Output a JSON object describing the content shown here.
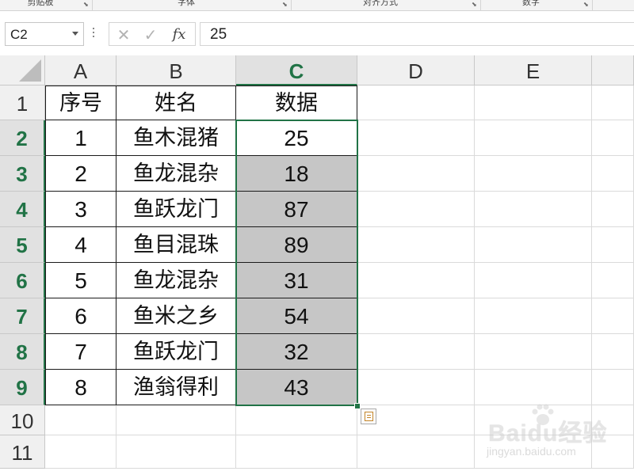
{
  "ribbon": {
    "groups": [
      {
        "label": "剪贴板"
      },
      {
        "label": "字体"
      },
      {
        "label": "对齐方式"
      },
      {
        "label": "数字"
      }
    ]
  },
  "formula_bar": {
    "name_box": "C2",
    "cancel_icon": "x-icon",
    "enter_icon": "check-icon",
    "fx_label": "fx",
    "value": "25"
  },
  "columns": [
    "A",
    "B",
    "C",
    "D",
    "E"
  ],
  "rows": [
    "1",
    "2",
    "3",
    "4",
    "5",
    "6",
    "7",
    "8",
    "9",
    "10",
    "11"
  ],
  "selected_column": "C",
  "selected_rows": [
    "2",
    "3",
    "4",
    "5",
    "6",
    "7",
    "8",
    "9"
  ],
  "table": {
    "headers": [
      "序号",
      "姓名",
      "数据"
    ],
    "rows": [
      [
        "1",
        "鱼木混猪",
        "25"
      ],
      [
        "2",
        "鱼龙混杂",
        "18"
      ],
      [
        "3",
        "鱼跃龙门",
        "87"
      ],
      [
        "4",
        "鱼目混珠",
        "89"
      ],
      [
        "5",
        "鱼龙混杂",
        "31"
      ],
      [
        "6",
        "鱼米之乡",
        "54"
      ],
      [
        "7",
        "鱼跃龙门",
        "32"
      ],
      [
        "8",
        "渔翁得利",
        "43"
      ]
    ]
  },
  "colors": {
    "selection_green": "#217346",
    "shaded_cell": "#c6c6c6"
  },
  "watermark": {
    "brand": "Baidu经验",
    "url": "jingyan.baidu.com"
  }
}
